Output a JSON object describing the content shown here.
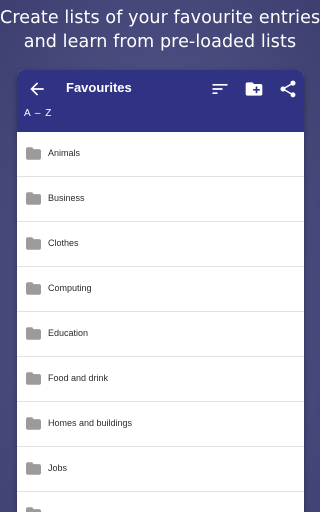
{
  "promo": {
    "line1": "Create lists of your favourite entries",
    "line2": "and learn from pre-loaded lists"
  },
  "appbar": {
    "title": "Favourites",
    "sort_label": "A – Z",
    "color": "#303383",
    "icons": [
      "arrow-back-icon",
      "sort-icon",
      "create-new-folder-icon",
      "share-icon"
    ]
  },
  "list": {
    "icon": "folder-icon",
    "items": [
      {
        "label": "Animals"
      },
      {
        "label": "Business"
      },
      {
        "label": "Clothes"
      },
      {
        "label": "Computing"
      },
      {
        "label": "Education"
      },
      {
        "label": "Food and drink"
      },
      {
        "label": "Homes and buildings"
      },
      {
        "label": "Jobs"
      },
      {
        "label": ""
      }
    ]
  }
}
